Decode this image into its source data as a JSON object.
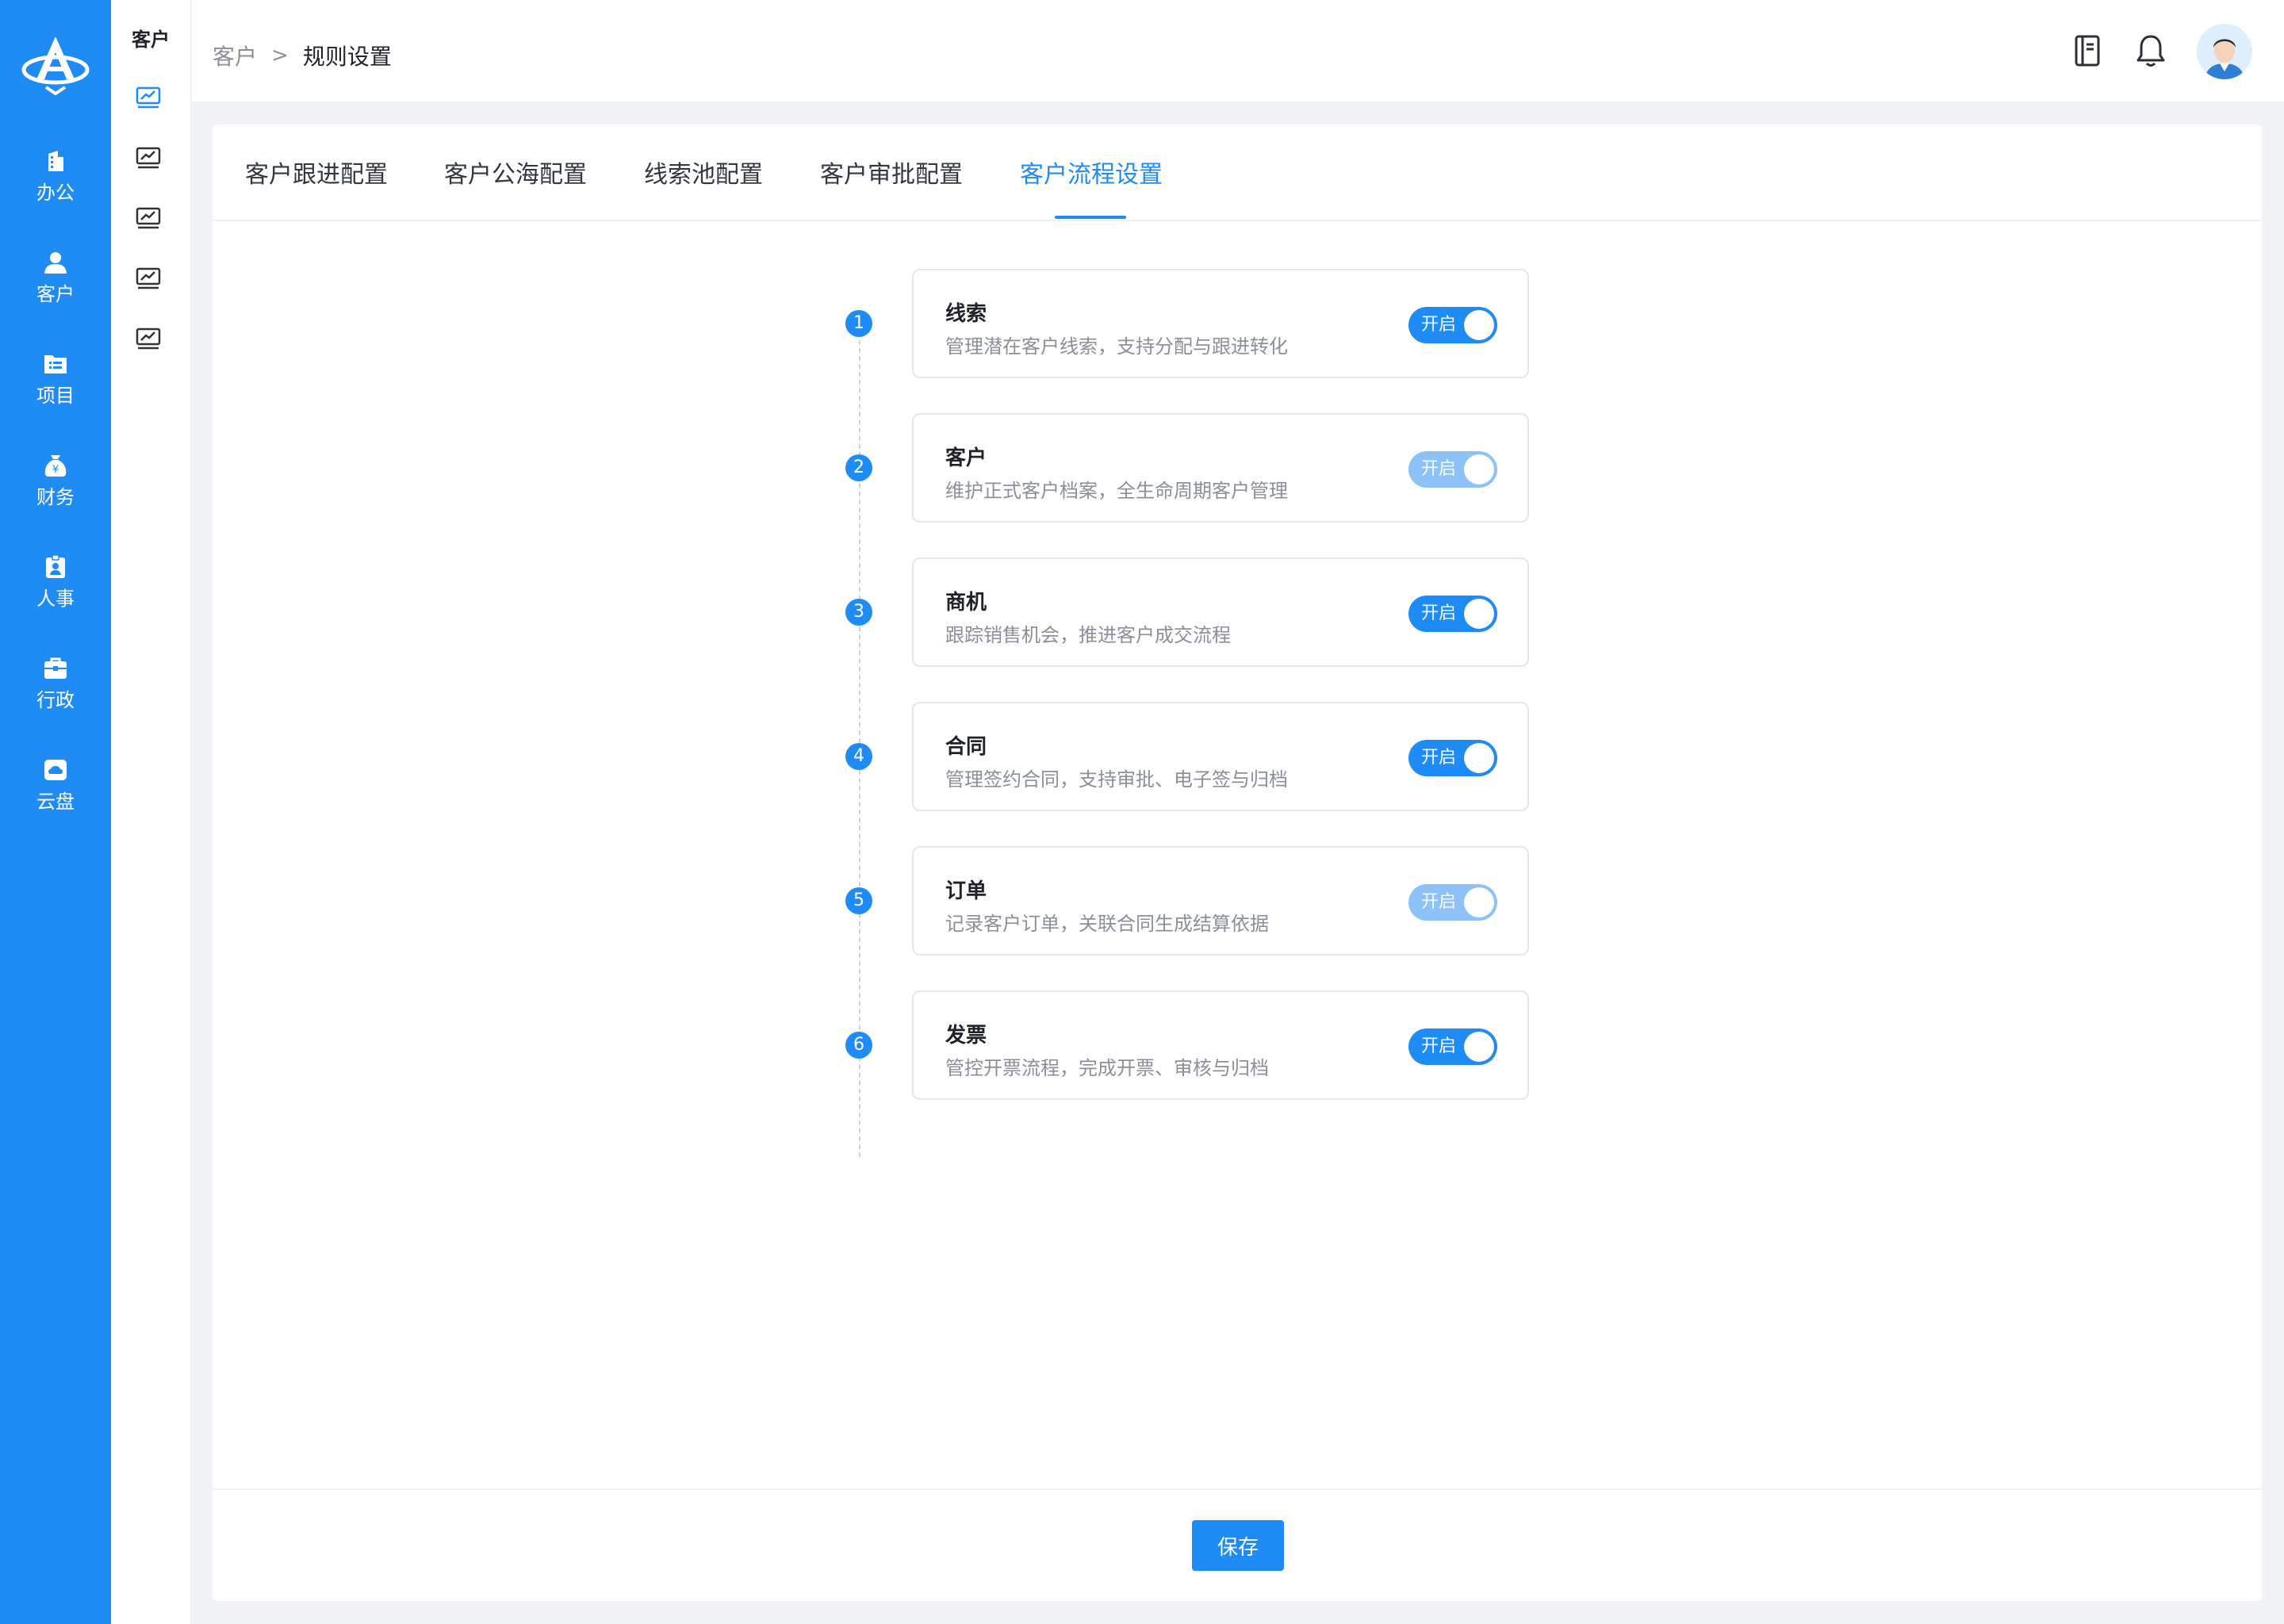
{
  "nav": {
    "items": [
      {
        "label": "办公",
        "icon": "building-icon"
      },
      {
        "label": "客户",
        "icon": "user-icon"
      },
      {
        "label": "项目",
        "icon": "folder-list-icon"
      },
      {
        "label": "财务",
        "icon": "money-bag-icon"
      },
      {
        "label": "人事",
        "icon": "badge-icon"
      },
      {
        "label": "行政",
        "icon": "briefcase-icon"
      },
      {
        "label": "云盘",
        "icon": "cloud-drive-icon"
      }
    ]
  },
  "subnav": {
    "title": "客户",
    "items": [
      "chart-icon",
      "chart-icon",
      "chart-icon",
      "chart-icon",
      "chart-icon"
    ]
  },
  "header": {
    "breadcrumb": {
      "parent": "客户",
      "separator": ">",
      "current": "规则设置"
    },
    "icons": [
      "notebook-icon",
      "bell-icon",
      "avatar"
    ]
  },
  "tabs": [
    {
      "label": "客户跟进配置",
      "active": false
    },
    {
      "label": "客户公海配置",
      "active": false
    },
    {
      "label": "线索池配置",
      "active": false
    },
    {
      "label": "客户审批配置",
      "active": false
    },
    {
      "label": "客户流程设置",
      "active": true
    }
  ],
  "steps": [
    {
      "num": "1",
      "title": "线索",
      "desc": "管理潜在客户线索，支持分配与跟进转化",
      "toggle": "开启",
      "enabled": true
    },
    {
      "num": "2",
      "title": "客户",
      "desc": "维护正式客户档案，全生命周期客户管理",
      "toggle": "开启",
      "enabled": false
    },
    {
      "num": "3",
      "title": "商机",
      "desc": "跟踪销售机会，推进客户成交流程",
      "toggle": "开启",
      "enabled": true
    },
    {
      "num": "4",
      "title": "合同",
      "desc": "管理签约合同，支持审批、电子签与归档",
      "toggle": "开启",
      "enabled": true
    },
    {
      "num": "5",
      "title": "订单",
      "desc": "记录客户订单，关联合同生成结算依据",
      "toggle": "开启",
      "enabled": false
    },
    {
      "num": "6",
      "title": "发票",
      "desc": "管控开票流程，完成开票、审核与归档",
      "toggle": "开启",
      "enabled": true
    }
  ],
  "footer": {
    "save_label": "保存"
  },
  "colors": {
    "primary": "#1f8bf5",
    "primary_dim": "#8cc2f8",
    "text": "#1f2329",
    "muted": "#8a8f99"
  }
}
